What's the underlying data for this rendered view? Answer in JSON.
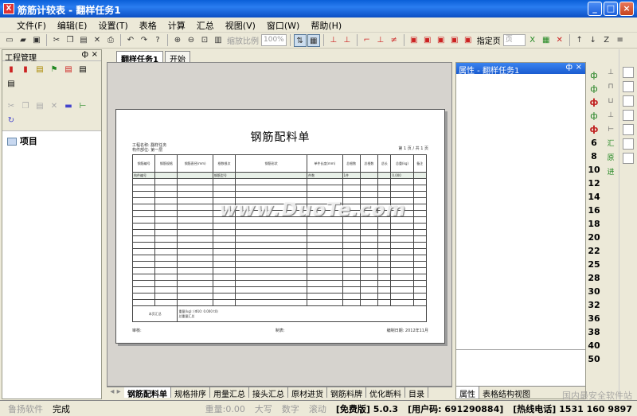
{
  "window": {
    "title": "筋筋计较表 - 翻样任务1",
    "buttons": [
      "_",
      "□",
      "×"
    ]
  },
  "menu": [
    "文件(F)",
    "编辑(E)",
    "设置(T)",
    "表格",
    "计算",
    "汇总",
    "视图(V)",
    "窗口(W)",
    "帮助(H)"
  ],
  "toolbar": {
    "zoom_label": "缩放比例",
    "zoom_value": "100%",
    "page_label": "指定页",
    "page_value": "页"
  },
  "left_panel": {
    "title": "工程管理",
    "pin": "ф",
    "close": "×",
    "tree_root": "项目"
  },
  "doc_tabs": [
    "翻样任务1",
    "开始"
  ],
  "paper": {
    "title": "钢筋配料单",
    "meta_left": [
      "工程名称: 翻样任务",
      "构件部位: 第一层"
    ],
    "meta_right": "第 1 页 / 共 1 页",
    "headers": [
      "钢筋编号",
      "钢筋规格",
      "钢筋直径(mm)",
      "根数根次",
      "钢筋形状",
      "(mm)",
      "单件长度(mm)",
      "总根数",
      "总根数",
      "总长",
      "(m)",
      "总重(kg)",
      "备注"
    ],
    "row1": [
      "构件编号",
      "",
      "",
      "钢筋型号",
      "",
      "",
      "件数",
      "1件",
      "",
      "",
      "",
      "0.000",
      ""
    ],
    "footer_left": "本页汇总",
    "footer_text": "重量(kg): (Φ10: 0.000 t0)",
    "footer_text2": "总重量汇总",
    "sign_left": "审核:",
    "sign_mid": "制表:",
    "sign_right": "编制日期: 2012年11月"
  },
  "watermark": "www.DuoTe.com",
  "bottom_tabs": [
    "钢筋配料单",
    "规格排序",
    "用量汇总",
    "接头汇总",
    "原材进货",
    "钢筋料牌",
    "优化断料",
    "目录"
  ],
  "right_panel": {
    "title": "属性 - 翻样任务1",
    "pin": "ф",
    "close": "×",
    "tabs": [
      "属性",
      "表格结构视图"
    ]
  },
  "sidebar_numbers": [
    "6",
    "8",
    "10",
    "12",
    "14",
    "16",
    "18",
    "20",
    "22",
    "25",
    "28",
    "30",
    "32",
    "36",
    "38",
    "40",
    "50"
  ],
  "sidebar_glyphs": [
    "汇",
    "原",
    "进"
  ],
  "status": {
    "company": "鲁扬软件",
    "state": "完成",
    "weight": "重量:0.00",
    "caps": "大写",
    "num": "数字",
    "scroll": "滚动",
    "edition": "[免费版] 5.0.3",
    "user": "[用户码: 691290884]",
    "hotline": "[热线电话] 1531 160 9897"
  },
  "brand": "国内最安全软件站"
}
